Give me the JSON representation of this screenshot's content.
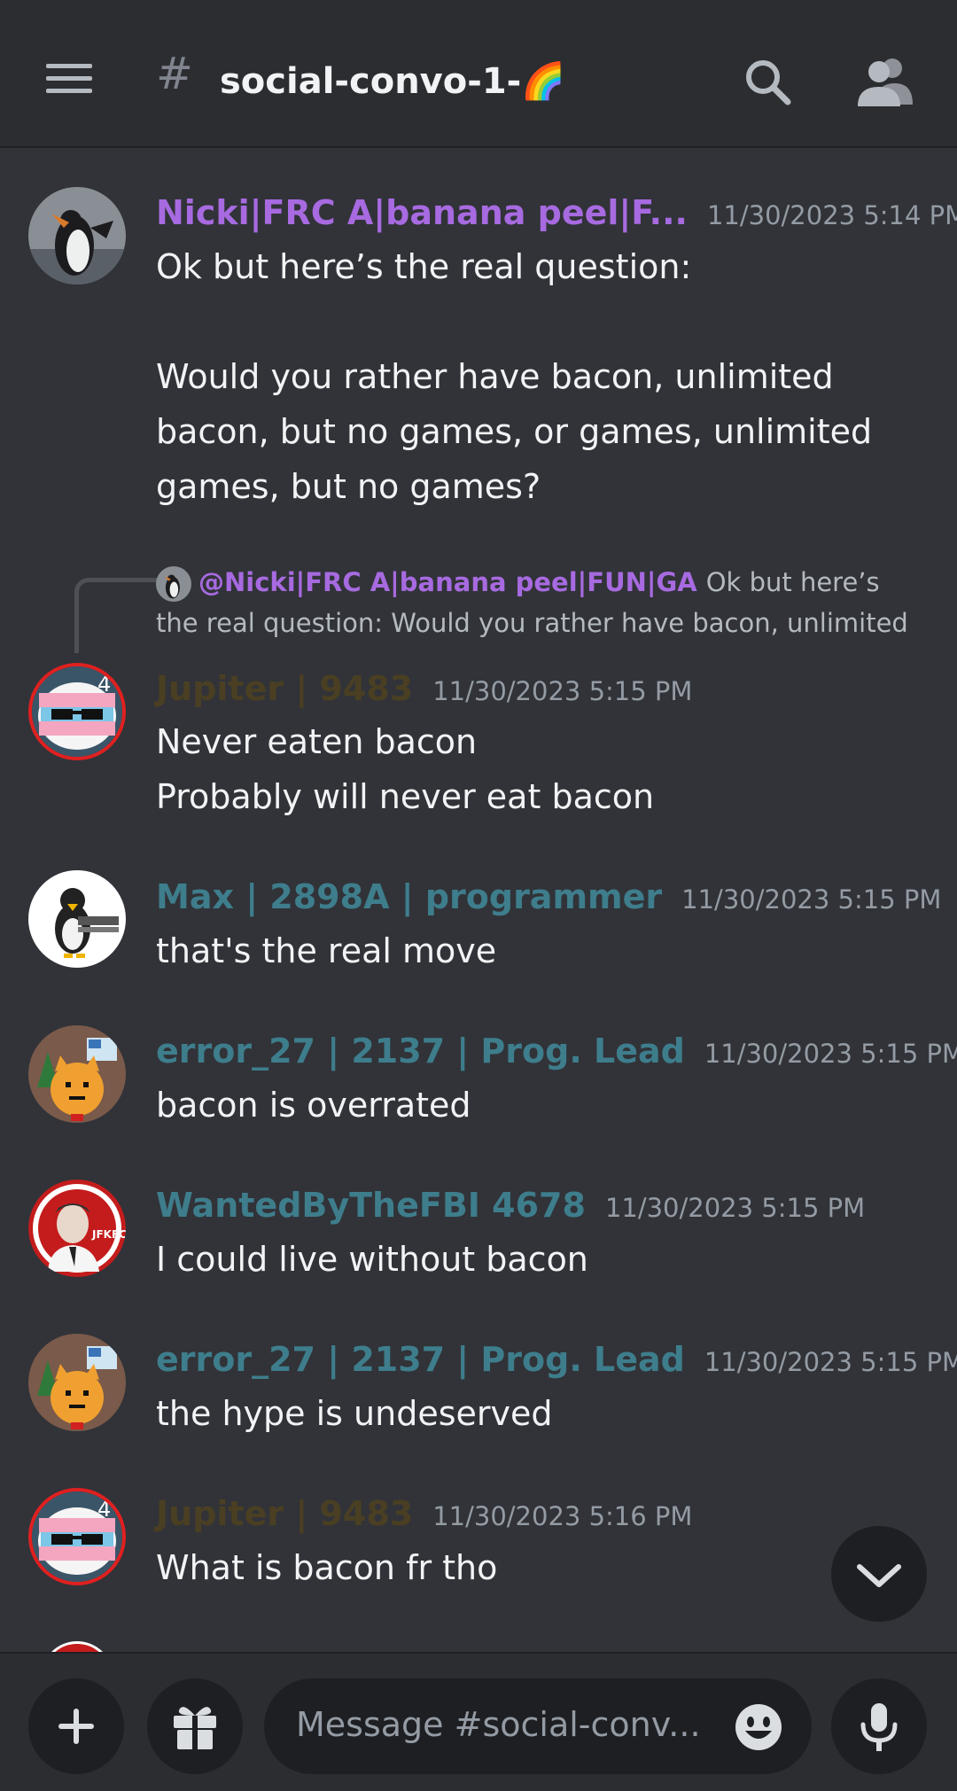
{
  "header": {
    "channel_prefix": "#",
    "channel_name": "social-convo-1-🌈"
  },
  "messages": [
    {
      "username": "Nicki|FRC A|banana peel|F...",
      "username_color": "#a76ae0",
      "timestamp": "11/30/2023 5:14 PM",
      "text": "Ok but here’s the real question:\n\nWould you rather have bacon, unlimited bacon, but no games, or games, unlimited games, but no games?"
    },
    {
      "username": "Jupiter | 9483",
      "username_color": "#4a3f22",
      "timestamp": "11/30/2023 5:15 PM",
      "text": "Never eaten bacon\nProbably will never eat bacon",
      "reply": {
        "username": "@Nicki|FRC A|banana peel|FUN|GA",
        "text": "Ok but here’s the real question:  Would you rather have bacon, unlimited"
      }
    },
    {
      "username": "Max | 2898A | programmer",
      "username_color": "#3e7d8c",
      "timestamp": "11/30/2023 5:15 PM",
      "text": "that's the real move"
    },
    {
      "username": "error_27 | 2137 | Prog. Lead",
      "username_color": "#3e7d8c",
      "timestamp": "11/30/2023 5:15 PM",
      "text": "bacon is overrated"
    },
    {
      "username": "WantedByTheFBI 4678",
      "username_color": "#3e7d8c",
      "timestamp": "11/30/2023 5:15 PM",
      "text": "I could live without bacon",
      "avatar_label": "JFKFC"
    },
    {
      "username": "error_27 | 2137 | Prog. Lead",
      "username_color": "#3e7d8c",
      "timestamp": "11/30/2023 5:15 PM",
      "text": "the hype is undeserved"
    },
    {
      "username": "Jupiter | 9483",
      "username_color": "#4a3f22",
      "timestamp": "11/30/2023 5:16 PM",
      "text": "What is bacon fr tho"
    }
  ],
  "composer": {
    "placeholder": "Message #social-conv..."
  },
  "icons": {
    "menu": "hamburger-menu-icon",
    "search": "search-icon",
    "members": "members-icon",
    "scroll_down": "chevron-down-icon",
    "add": "plus-icon",
    "gift": "gift-icon",
    "emoji": "emoji-icon",
    "mic": "microphone-icon"
  }
}
